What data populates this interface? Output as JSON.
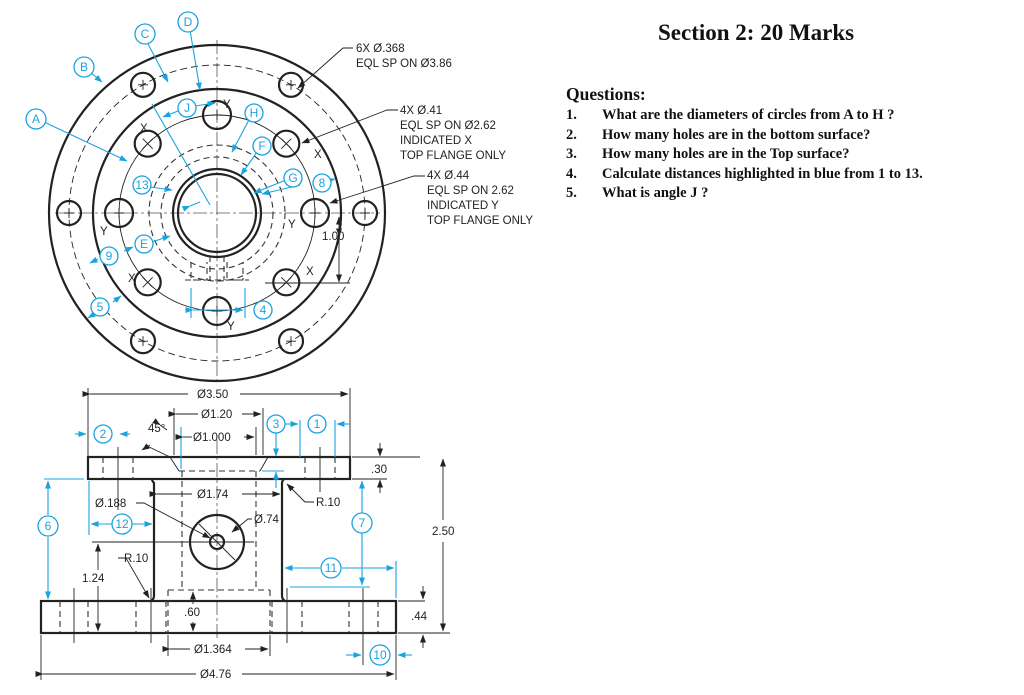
{
  "section": {
    "title": "Section 2: 20 Marks"
  },
  "questions": {
    "heading": "Questions:",
    "items": [
      {
        "num": "1.",
        "text": "What are the diameters of circles from A to H ?"
      },
      {
        "num": "2.",
        "text": "How many holes are in the bottom surface?"
      },
      {
        "num": "3.",
        "text": "How many holes are in the Top surface?"
      },
      {
        "num": "4.",
        "text": "Calculate distances highlighted in blue from 1 to 13."
      },
      {
        "num": "5.",
        "text": "What is angle J ?"
      }
    ]
  },
  "drawing": {
    "accent_color": "#1aa3e0",
    "top_view": {
      "notes": {
        "bolt_holes": [
          "6X  Ø.368",
          "EQL SP ON Ø3.86"
        ],
        "holes_x": [
          "4X  Ø.41",
          "EQL SP ON Ø2.62",
          "INDICATED X",
          "TOP FLANGE ONLY"
        ],
        "holes_y": [
          "4X  Ø.44",
          "EQL SP ON  2.62",
          "INDICATED Y",
          "TOP FLANGE ONLY"
        ]
      },
      "hole_marks": {
        "x": "X",
        "y": "Y"
      },
      "dim_1_00": "1.00",
      "letter_callouts": [
        "A",
        "B",
        "C",
        "D",
        "E",
        "F",
        "G",
        "H",
        "J"
      ],
      "number_callouts": [
        "4",
        "5",
        "8",
        "9",
        "13"
      ]
    },
    "front_view": {
      "dims": {
        "d3_50": "Ø3.50",
        "d1_20": "Ø1.20",
        "d1_000": "Ø1.000",
        "angle45": "45°",
        "t30": ".30",
        "d1_74": "Ø1.74",
        "r10_top": "R.10",
        "d188": "Ø.188",
        "d74": "Ø.74",
        "r10_bottom": "R.10",
        "h1_24": "1.24",
        "h2_50": "2.50",
        "d60": ".60",
        "t44": ".44",
        "d1_364": "Ø1.364",
        "d4_76": "Ø4.76"
      },
      "number_callouts": [
        "1",
        "2",
        "3",
        "6",
        "7",
        "10",
        "11",
        "12"
      ]
    }
  }
}
